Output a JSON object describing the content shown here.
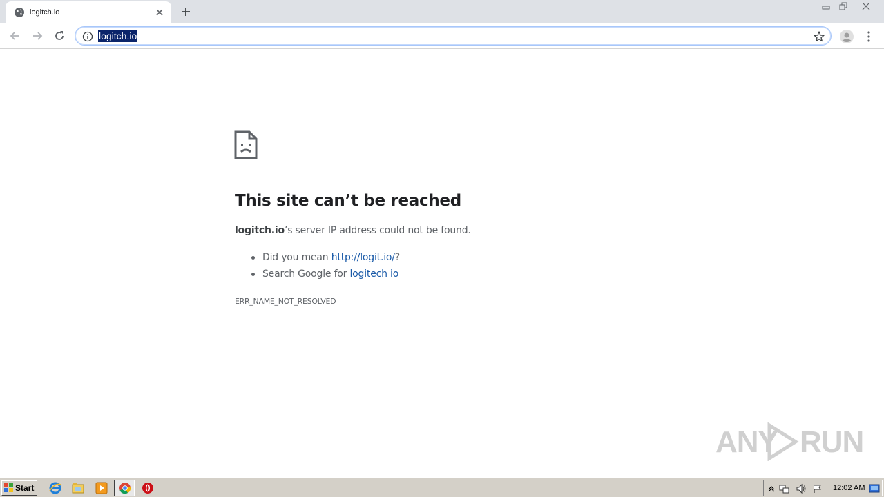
{
  "tab": {
    "title": "logitch.io"
  },
  "omnibox": {
    "url": "logitch.io"
  },
  "error": {
    "headline": "This site can’t be reached",
    "host": "logitch.io",
    "summary_rest": "’s server IP address could not be found.",
    "suggestion1_prefix": "Did you mean ",
    "suggestion1_link": "http://logit.io/",
    "suggestion1_suffix": "?",
    "suggestion2_prefix": "Search Google for ",
    "suggestion2_link": "logitech io",
    "code": "ERR_NAME_NOT_RESOLVED"
  },
  "watermark": {
    "left": "ANY",
    "right": "RUN"
  },
  "taskbar": {
    "start_label": "Start",
    "clock": "12:02 AM",
    "apps": [
      "internet-explorer-icon",
      "file-explorer-icon",
      "media-player-icon",
      "chrome-icon",
      "opera-icon"
    ]
  },
  "colors": {
    "link": "#1a5aa8",
    "text": "#5f6368",
    "heading": "#202124",
    "selection": "#0a246a"
  }
}
